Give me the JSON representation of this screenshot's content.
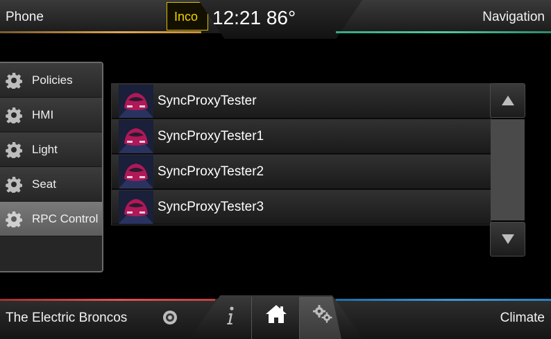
{
  "header": {
    "phone_label": "Phone",
    "alert_text": "Inco",
    "clock": "12:21 86°",
    "navigation_label": "Navigation"
  },
  "menu": {
    "items": [
      {
        "label": "Policies",
        "icon": "gear-icon"
      },
      {
        "label": "HMI",
        "icon": "gear-icon"
      },
      {
        "label": "Light",
        "icon": "gear-icon"
      },
      {
        "label": "Seat",
        "icon": "gear-icon"
      },
      {
        "label": "RPC Control",
        "icon": "gear-icon",
        "active": true
      }
    ]
  },
  "apps": {
    "items": [
      {
        "name": "SyncProxyTester"
      },
      {
        "name": "SyncProxyTester1"
      },
      {
        "name": "SyncProxyTester2"
      },
      {
        "name": "SyncProxyTester3"
      }
    ]
  },
  "footer": {
    "media_label": "The Electric Broncos",
    "climate_label": "Climate",
    "icons": [
      "cd-icon",
      "info-icon",
      "home-icon",
      "settings-gears-icon"
    ]
  },
  "colors": {
    "phone_accent": "#e0a552",
    "navigation_accent": "#55c79a",
    "media_accent": "#e05252",
    "climate_accent": "#3a9ad8",
    "alert_border": "#d8c200"
  }
}
